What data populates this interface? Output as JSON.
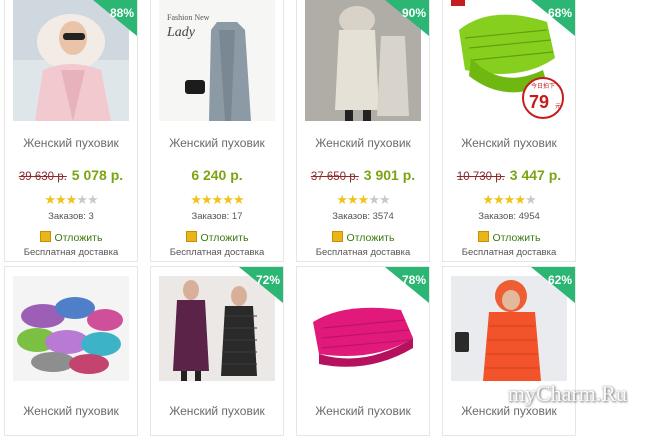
{
  "colors": {
    "badge_green": "#2bb673",
    "price_green": "#7aa510",
    "old_price_red": "#8a2b2b",
    "star_gold": "#f0c21a"
  },
  "products": [
    {
      "title": "Женский пуховик",
      "discount": "88%",
      "old_price": "39 630 р.",
      "price": "5 078 р.",
      "stars_on": "★★★",
      "stars_off": "★★",
      "orders": "Заказов: 3",
      "wish": "Отложить",
      "delivery": "Бесплатная доставка"
    },
    {
      "title": "Женский пуховик",
      "discount": "",
      "old_price": "",
      "price": "6 240 р.",
      "stars_on": "★★★★★",
      "stars_off": "",
      "orders": "Заказов: 17",
      "wish": "Отложить",
      "delivery": "Бесплатная доставка"
    },
    {
      "title": "Женский пуховик",
      "discount": "90%",
      "old_price": "37 650 р.",
      "price": "3 901 р.",
      "stars_on": "★★★",
      "stars_off": "★★",
      "orders": "Заказов: 3574",
      "wish": "Отложить",
      "delivery": "Бесплатная доставка"
    },
    {
      "title": "Женский пуховик",
      "discount": "68%",
      "old_price": "10 730 р.",
      "price": "3 447 р.",
      "stars_on": "★★★★",
      "stars_off": "★",
      "orders": "Заказов: 4954",
      "wish": "Отложить",
      "delivery": "Бесплатная доставка"
    },
    {
      "title": "Женский пуховик",
      "discount": ""
    },
    {
      "title": "Женский пуховик",
      "discount": "72%"
    },
    {
      "title": "Женский пуховик",
      "discount": "78%"
    },
    {
      "title": "Женский пуховик",
      "discount": "62%"
    }
  ],
  "photo_texts": {
    "fashion_new": "Fashion New",
    "lady": "Lady",
    "promo_line": "今日拍下",
    "promo_price": "79",
    "promo_unit": "元"
  },
  "watermark": "myCharm.Ru"
}
